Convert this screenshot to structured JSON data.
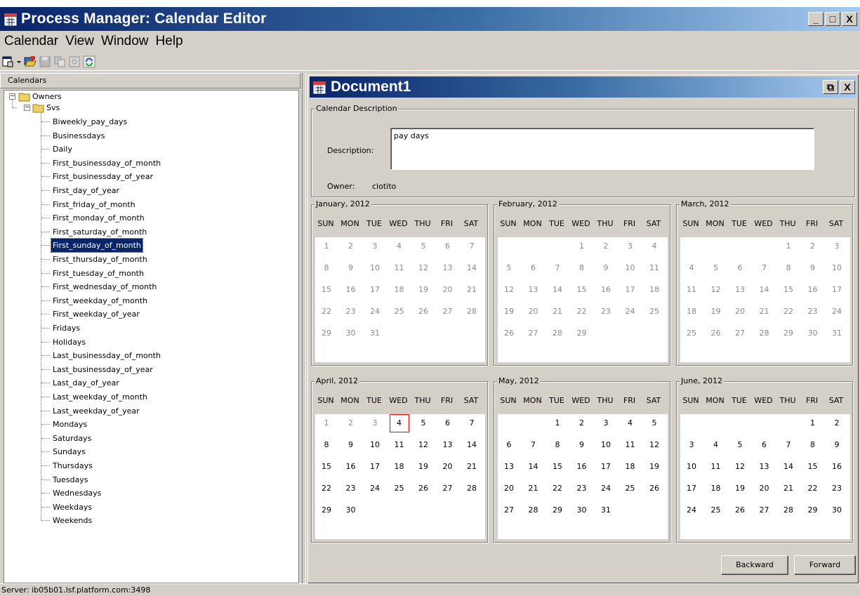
{
  "app": {
    "title": "Process Manager: Calendar Editor",
    "min_glyph": "_",
    "max_glyph": "□",
    "close_glyph": "X"
  },
  "menu": [
    "Calendar",
    "View",
    "Window",
    "Help"
  ],
  "toolbar_icons": [
    "new-calendar-icon",
    "dropdown-arrow-icon",
    "open-icon",
    "save-icon",
    "copy-icon",
    "preview-icon",
    "refresh-icon"
  ],
  "sidebar": {
    "header": "Calendars",
    "root": "Owners",
    "owner": "Svs",
    "selected_index": 9,
    "items": [
      "Biweekly_pay_days",
      "Businessdays",
      "Daily",
      "First_businessday_of_month",
      "First_businessday_of_year",
      "First_day_of_year",
      "First_friday_of_month",
      "First_monday_of_month",
      "First_saturday_of_month",
      "First_sunday_of_month",
      "First_thursday_of_month",
      "First_tuesday_of_month",
      "First_wednesday_of_month",
      "First_weekday_of_month",
      "First_weekday_of_year",
      "Fridays",
      "Holidays",
      "Last_businessday_of_month",
      "Last_businessday_of_year",
      "Last_day_of_year",
      "Last_weekday_of_month",
      "Last_weekday_of_year",
      "Mondays",
      "Saturdays",
      "Sundays",
      "Thursdays",
      "Tuesdays",
      "Wednesdays",
      "Weekdays",
      "Weekends"
    ]
  },
  "document": {
    "title": "Document1",
    "restore_glyph": "⧉",
    "close_glyph": "X",
    "group_label": "Calendar Description",
    "description_label": "Description:",
    "description_value": "pay days",
    "owner_label": "Owner:",
    "owner_value": "clotito"
  },
  "calendar": {
    "dow": [
      "SUN",
      "MON",
      "TUE",
      "WED",
      "THU",
      "FRI",
      "SAT"
    ],
    "today": {
      "month": 3,
      "day": 4
    },
    "months": [
      {
        "label": "January, 2012",
        "start": 0,
        "days": 31
      },
      {
        "label": "February, 2012",
        "start": 3,
        "days": 29
      },
      {
        "label": "March, 2012",
        "start": 4,
        "days": 31
      },
      {
        "label": "April, 2012",
        "start": 0,
        "days": 30
      },
      {
        "label": "May, 2012",
        "start": 2,
        "days": 31
      },
      {
        "label": "June, 2012",
        "start": 5,
        "days": 30
      }
    ]
  },
  "buttons": {
    "backward": "Backward",
    "forward": "Forward"
  },
  "status": "Server: ib05b01.lsf.platform.com:3498"
}
